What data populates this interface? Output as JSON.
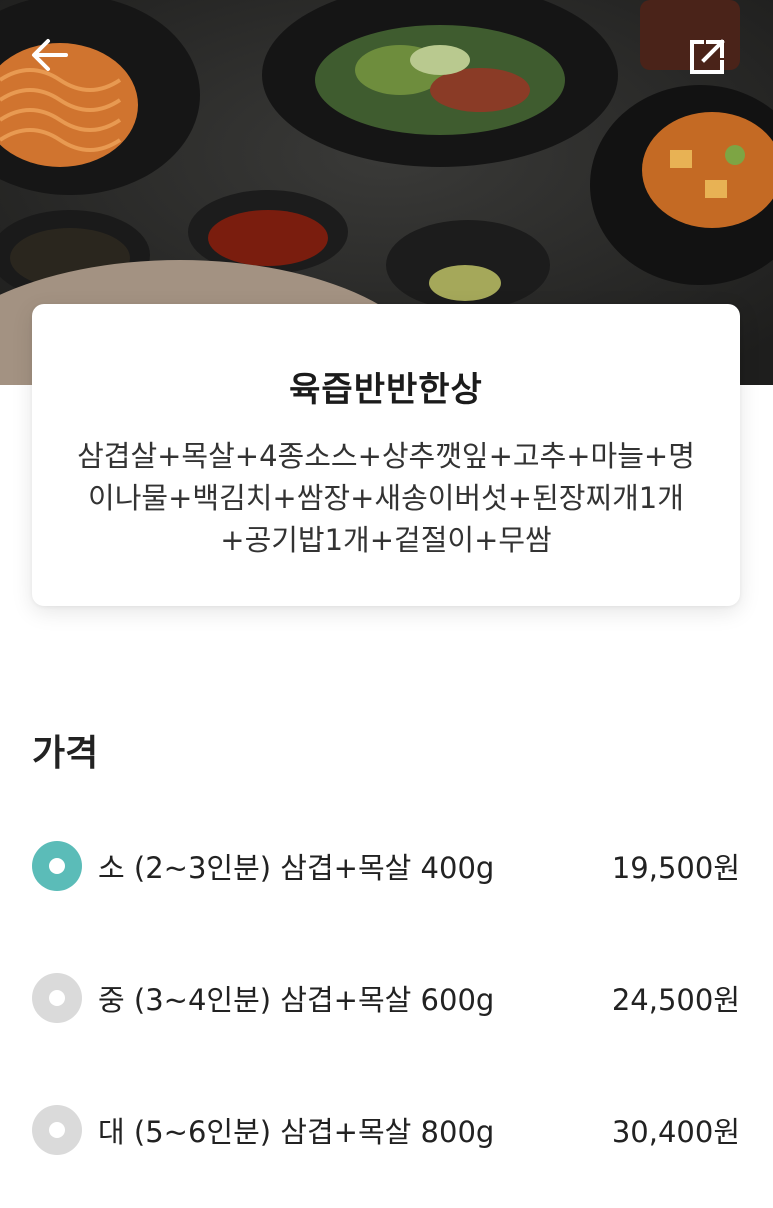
{
  "header": {
    "back_icon": "arrow-left-icon",
    "share_icon": "external-share-icon",
    "hero_image": "food-photo"
  },
  "menu": {
    "title": "육즙반반한상",
    "description": "삼겹살+목살+4종소스+상추깻잎+고추+마늘+명이나물+백김치+쌈장+새송이버섯+된장찌개1개+공기밥1개+겉절이+무쌈"
  },
  "price_section": {
    "title": "가격",
    "options": [
      {
        "label": "소 (2~3인분) 삼겹+목살 400g",
        "price": "19,500원",
        "selected": true
      },
      {
        "label": "중 (3~4인분) 삼겹+목살 600g",
        "price": "24,500원",
        "selected": false
      },
      {
        "label": "대 (5~6인분) 삼겹+목살 800g",
        "price": "30,400원",
        "selected": false
      }
    ]
  },
  "colors": {
    "accent": "#5bbcb8",
    "radio_unselected": "#dadada"
  }
}
